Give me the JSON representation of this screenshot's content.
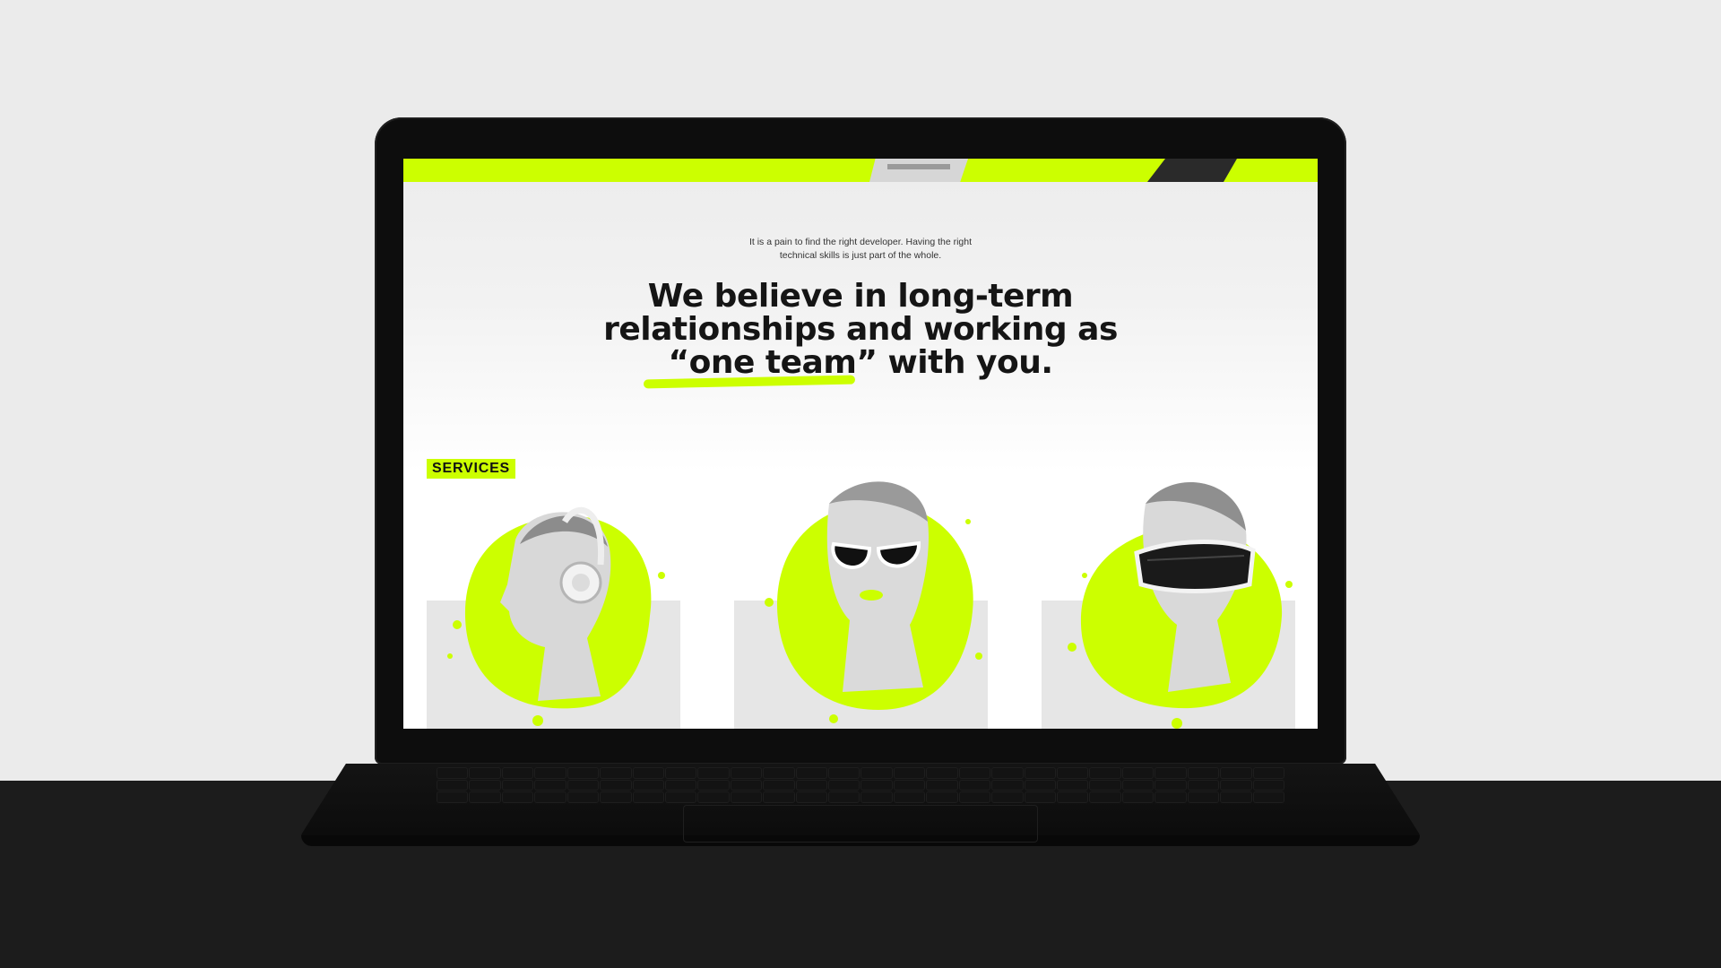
{
  "intro": {
    "line1": "It is a pain to find the right developer. Having the right",
    "line2": "technical skills is just part of the whole."
  },
  "headline": {
    "line1": "We believe in long-term",
    "line2": "relationships and working as",
    "line3": "“one team” with you."
  },
  "services": {
    "label": "SERVICES"
  },
  "cards": [
    {
      "icon": "headphones-bust-icon"
    },
    {
      "icon": "sunglasses-bust-icon"
    },
    {
      "icon": "vr-headset-bust-icon"
    }
  ],
  "colors": {
    "accent": "#ccff00",
    "text": "#151515",
    "card_bg": "#e6e6e6",
    "device": "#0d0d0d"
  }
}
